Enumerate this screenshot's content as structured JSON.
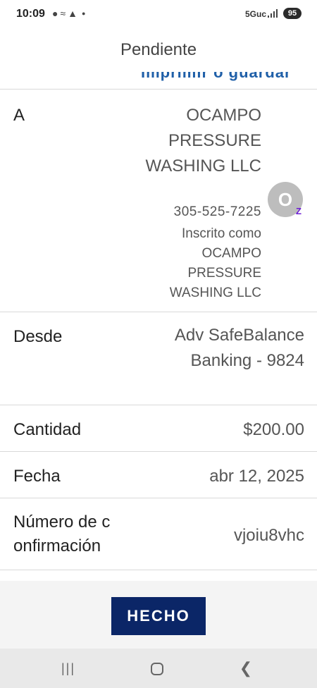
{
  "status_bar": {
    "time": "10:09",
    "network": "5Guc",
    "battery": "95",
    "icons": [
      "chat-icon",
      "wifi-icon",
      "snapchat-icon",
      "notification-dot-icon",
      "signal-icon",
      "battery-icon"
    ]
  },
  "header": {
    "title": "Pendiente"
  },
  "partial_link": "Imprimir o guardar",
  "details": {
    "to": {
      "label": "A",
      "name": "OCAMPO PRESSURE WASHING LLC",
      "phone": "305-525-7225",
      "enrolled": "Inscrito como OCAMPO PRESSURE WASHING LLC",
      "avatar_initial": "O",
      "badge": "Z"
    },
    "from": {
      "label": "Desde",
      "value": "Adv SafeBalance Banking - 9824"
    },
    "amount": {
      "label": "Cantidad",
      "value": "$200.00"
    },
    "date": {
      "label": "Fecha",
      "value": "abr 12, 2025"
    },
    "confirmation": {
      "label": "Número de c onfirmación",
      "value": "vjoiu8vhc"
    }
  },
  "done_button": "HECHO",
  "colors": {
    "button_bg": "#0b2667",
    "link": "#1f5fa8",
    "zelle_purple": "#6d1ed4"
  }
}
